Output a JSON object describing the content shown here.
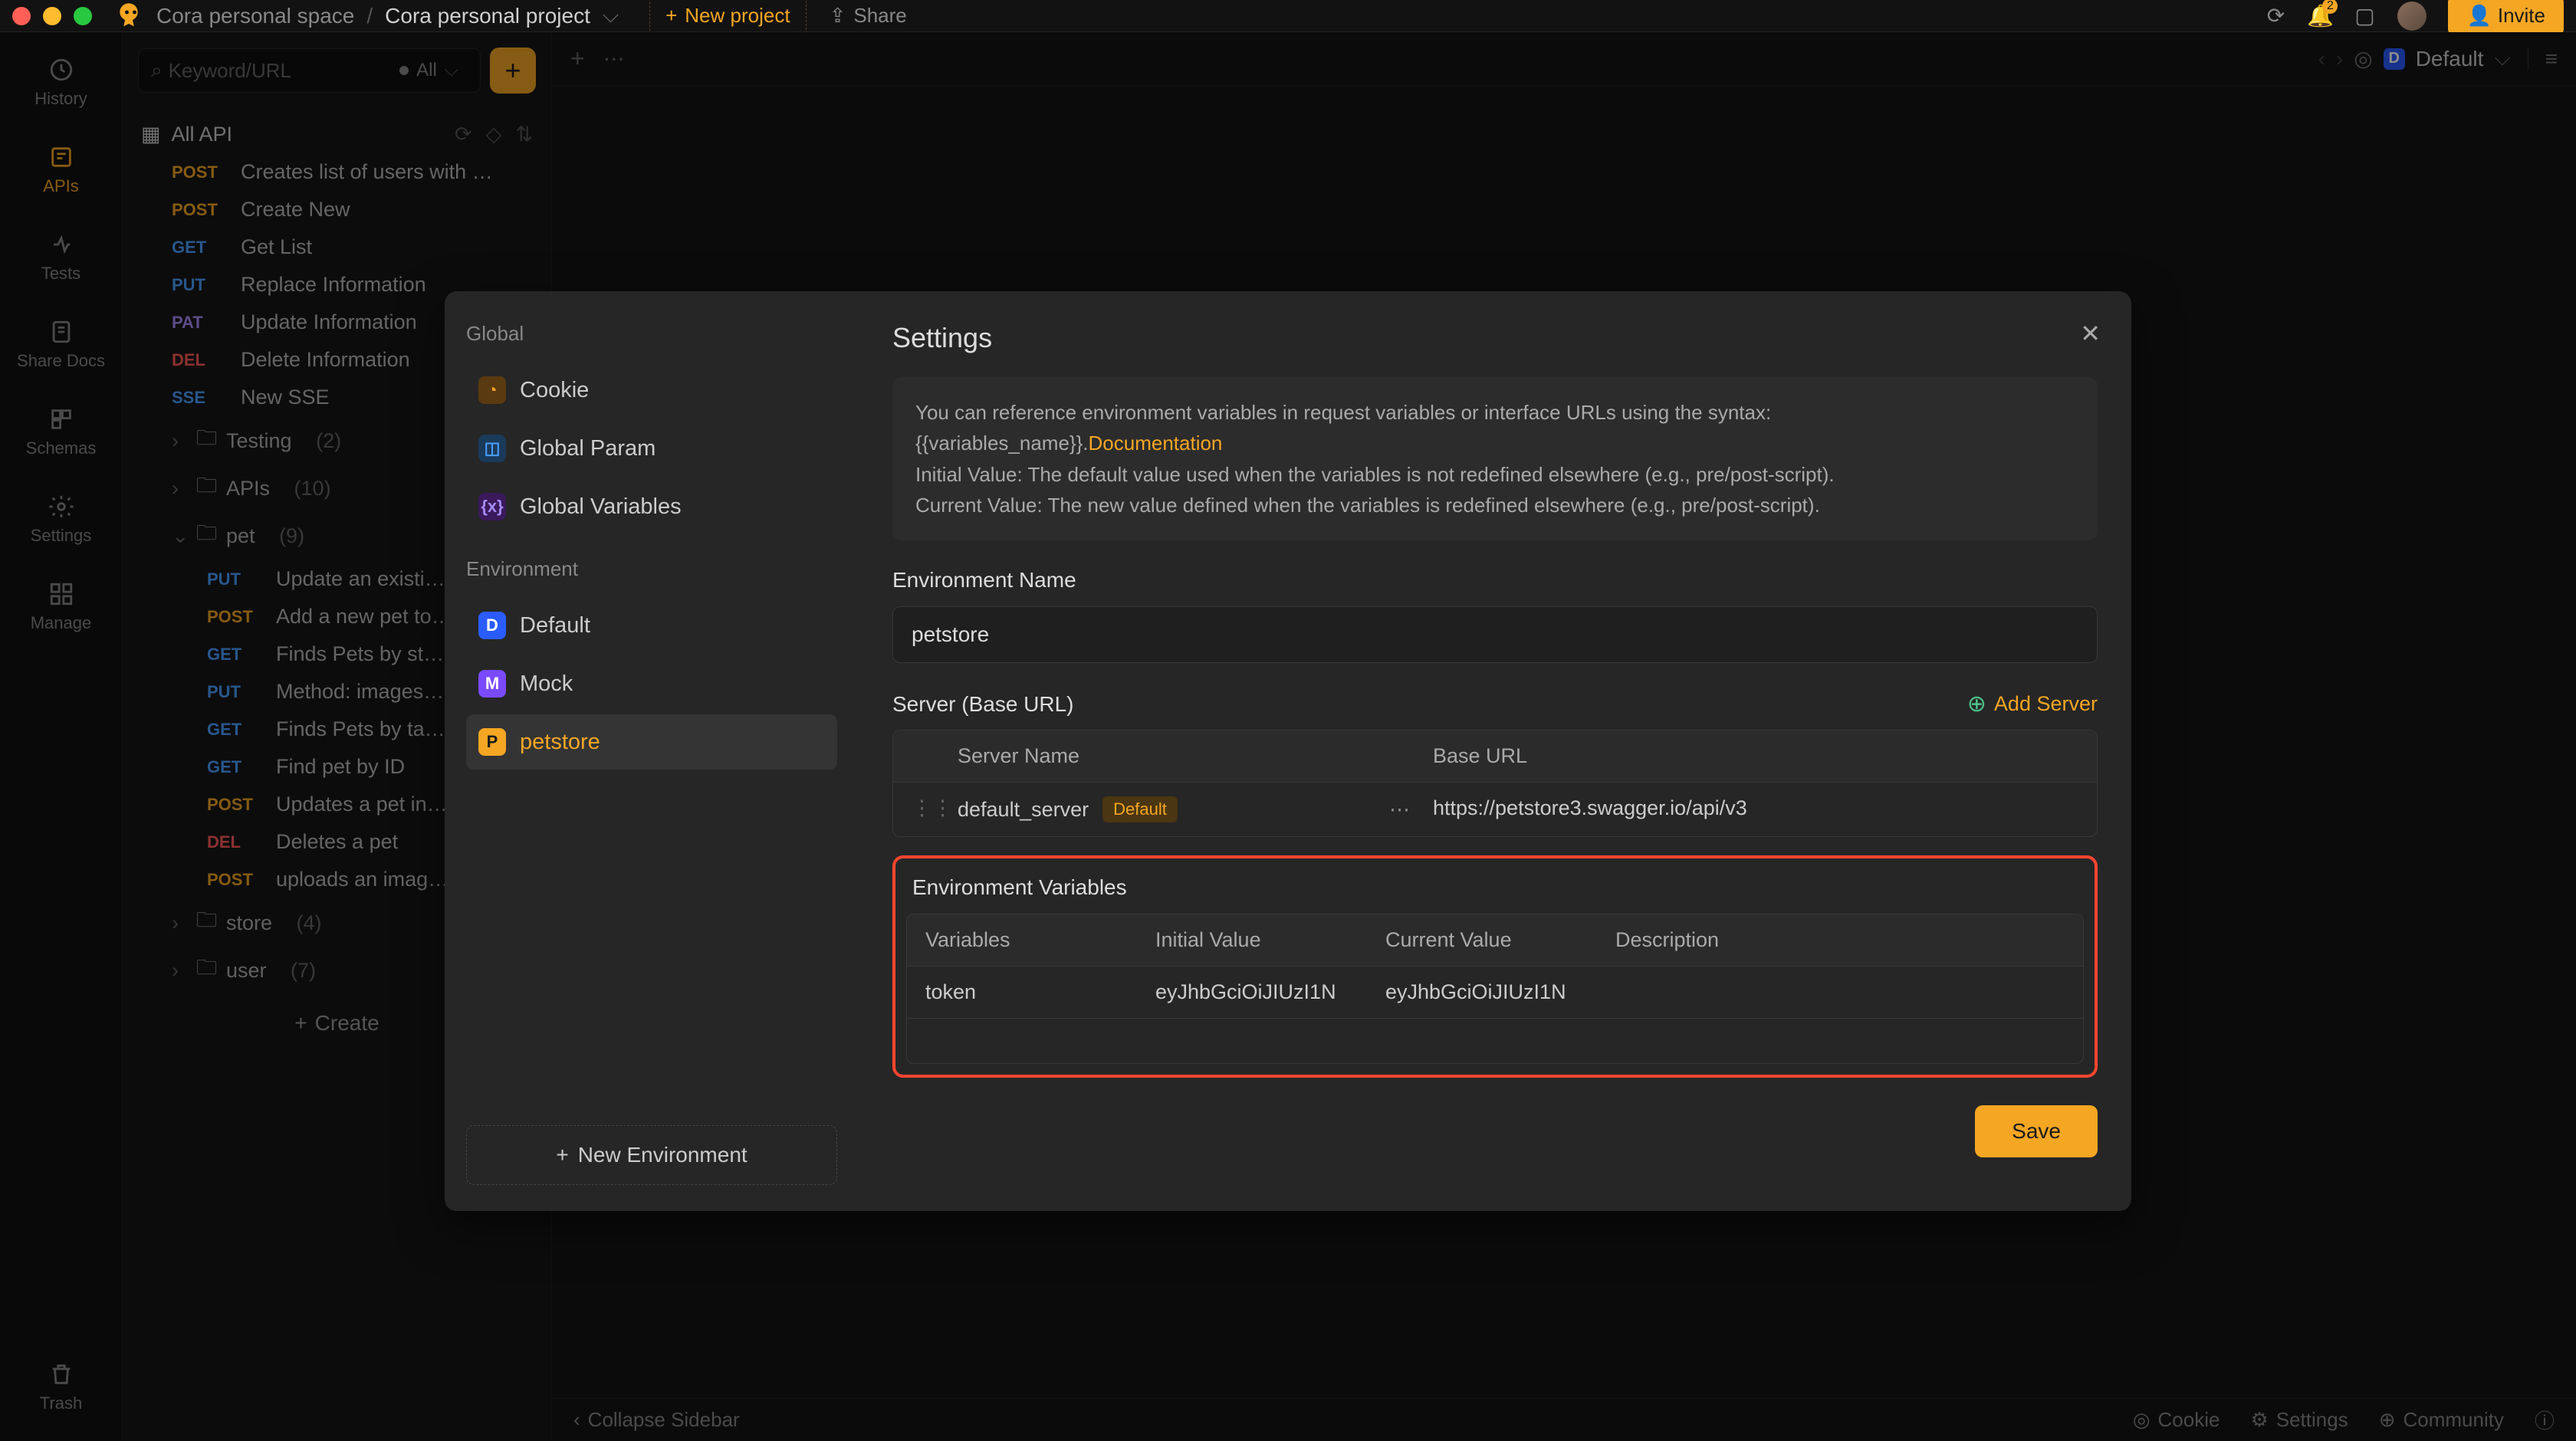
{
  "breadcrumb": {
    "space": "Cora personal space",
    "project": "Cora personal project"
  },
  "titlebar": {
    "new_project": "New project",
    "share": "Share",
    "invite": "Invite",
    "notif_count": "2"
  },
  "rail": {
    "history": "History",
    "apis": "APIs",
    "tests": "Tests",
    "share_docs": "Share Docs",
    "schemas": "Schemas",
    "settings": "Settings",
    "manage": "Manage",
    "trash": "Trash"
  },
  "search": {
    "placeholder": "Keyword/URL",
    "filter": "All"
  },
  "tree": {
    "all_api": "All API",
    "items": [
      {
        "m": "POST",
        "label": "Creates list of users with …"
      },
      {
        "m": "POST",
        "label": "Create New"
      },
      {
        "m": "GET",
        "label": "Get List"
      },
      {
        "m": "PUT",
        "label": "Replace Information"
      },
      {
        "m": "PAT",
        "label": "Update Information"
      },
      {
        "m": "DEL",
        "label": "Delete Information"
      },
      {
        "m": "SSE",
        "label": "New SSE"
      }
    ],
    "folders": {
      "testing": {
        "label": "Testing",
        "count": "(2)"
      },
      "apis": {
        "label": "APIs",
        "count": "(10)"
      },
      "pet": {
        "label": "pet",
        "count": "(9)",
        "items": [
          {
            "m": "PUT",
            "label": "Update an existi…"
          },
          {
            "m": "POST",
            "label": "Add a new pet to…"
          },
          {
            "m": "GET",
            "label": "Finds Pets by st…"
          },
          {
            "m": "PUT",
            "label": "Method: images…"
          },
          {
            "m": "GET",
            "label": "Finds Pets by ta…"
          },
          {
            "m": "GET",
            "label": "Find pet by ID"
          },
          {
            "m": "POST",
            "label": "Updates a pet in…"
          },
          {
            "m": "DEL",
            "label": "Deletes a pet"
          },
          {
            "m": "POST",
            "label": "uploads an imag…"
          }
        ]
      },
      "store": {
        "label": "store",
        "count": "(4)"
      },
      "user": {
        "label": "user",
        "count": "(7)"
      }
    },
    "create": "Create"
  },
  "env_pill": {
    "label": "Default"
  },
  "collapse_bar": {
    "collapse": "Collapse Sidebar",
    "cookie": "Cookie",
    "settings": "Settings",
    "community": "Community"
  },
  "modal": {
    "side": {
      "global_label": "Global",
      "cookie": "Cookie",
      "global_param": "Global Param",
      "global_vars": "Global Variables",
      "env_label": "Environment",
      "default": "Default",
      "mock": "Mock",
      "petstore": "petstore",
      "new_env": "New Environment"
    },
    "title": "Settings",
    "info_line1_a": "You can reference environment variables in request variables or interface URLs using the syntax: {{variables_name}}.",
    "info_doc": "Documentation",
    "info_line2": "Initial Value: The default value used when the variables is not redefined elsewhere (e.g., pre/post-script).",
    "info_line3": "Current Value: The new value defined when the variables is redefined elsewhere (e.g., pre/post-script).",
    "env_name_label": "Environment Name",
    "env_name_value": "petstore",
    "server_label": "Server (Base URL)",
    "add_server": "Add Server",
    "server_table": {
      "h_name": "Server Name",
      "h_url": "Base URL",
      "row": {
        "name": "default_server",
        "tag": "Default",
        "url": "https://petstore3.swagger.io/api/v3"
      }
    },
    "envvars_label": "Environment Variables",
    "vars_table": {
      "h_var": "Variables",
      "h_iv": "Initial Value",
      "h_cv": "Current Value",
      "h_desc": "Description",
      "row": {
        "var": "token",
        "iv": "eyJhbGciOiJIUzI1N",
        "cv": "eyJhbGciOiJIUzI1N",
        "desc": ""
      }
    },
    "save": "Save"
  }
}
